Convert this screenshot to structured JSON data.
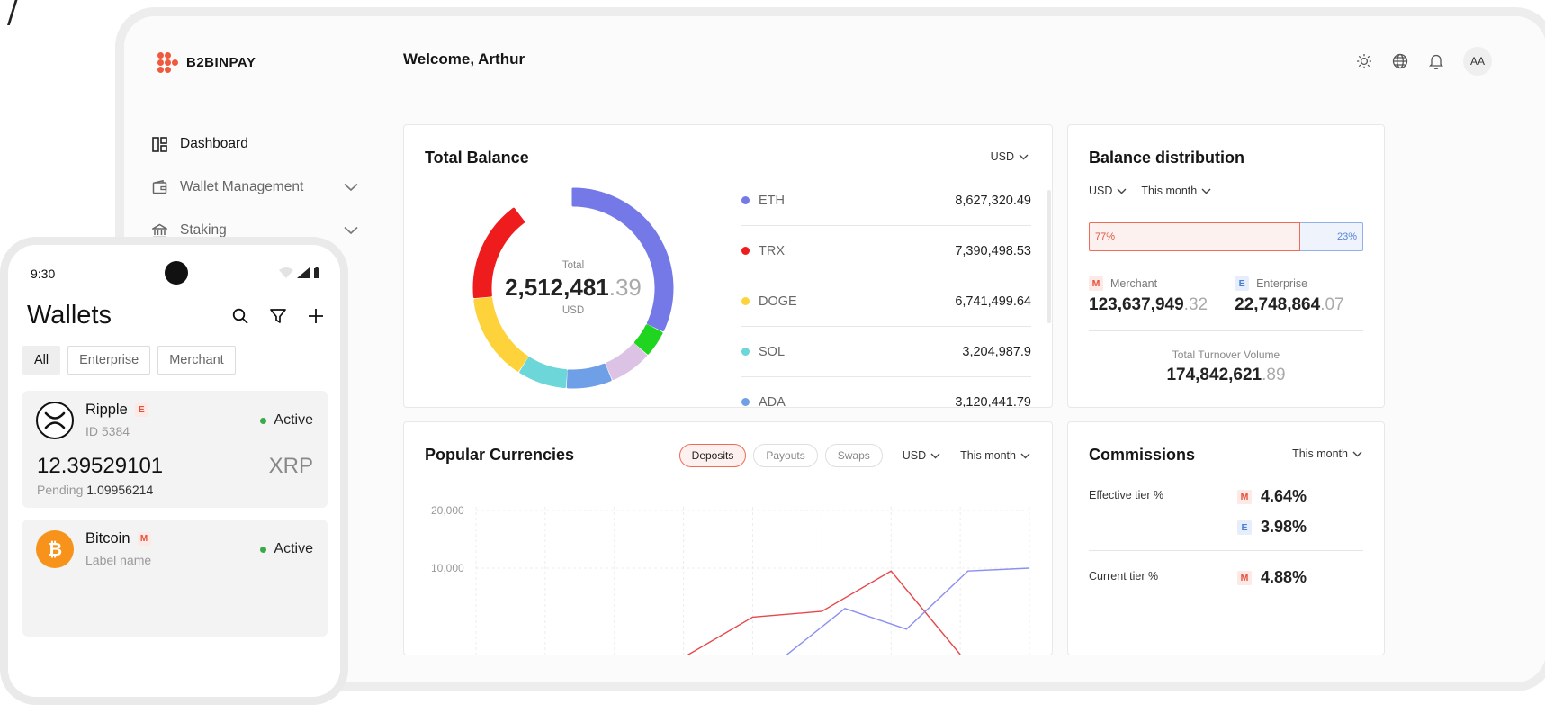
{
  "corner_glyph": "/",
  "brand": {
    "name": "B2BINPAY",
    "color": "#ef5a3c"
  },
  "sidebar": {
    "items": [
      {
        "label": "Dashboard",
        "icon": "dashboard-icon",
        "active": true
      },
      {
        "label": "Wallet Management",
        "icon": "wallet-icon",
        "expandable": true
      },
      {
        "label": "Staking",
        "icon": "bank-icon",
        "expandable": true
      }
    ]
  },
  "header": {
    "welcome": "Welcome, Arthur",
    "icons": [
      "sun-icon",
      "globe-icon",
      "bell-icon"
    ],
    "avatar": "AA"
  },
  "total_balance": {
    "title": "Total Balance",
    "currency": "USD",
    "center_label": "Total",
    "center_value_int": "2,512,481",
    "center_value_dec": ".39",
    "center_unit": "USD",
    "assets": [
      {
        "name": "ETH",
        "value": "8,627,320.49",
        "color": "#7579e8"
      },
      {
        "name": "TRX",
        "value": "7,390,498.53",
        "color": "#ee1c1c"
      },
      {
        "name": "DOGE",
        "value": "6,741,499.64",
        "color": "#fdd23a"
      },
      {
        "name": "SOL",
        "value": "3,204,987.9",
        "color": "#6cd6d8"
      },
      {
        "name": "ADA",
        "value": "3,120,441.79",
        "color": "#6f9fe7"
      }
    ],
    "donut_segments": [
      {
        "name": "ETH",
        "color": "#7579e8",
        "start_deg": 0,
        "end_deg": 115
      },
      {
        "name": "green",
        "color": "#1fd51f",
        "start_deg": 117,
        "end_deg": 131
      },
      {
        "name": "lavender",
        "color": "#dcc3e6",
        "start_deg": 133,
        "end_deg": 156
      },
      {
        "name": "ADA",
        "color": "#6f9fe7",
        "start_deg": 158,
        "end_deg": 183
      },
      {
        "name": "SOL",
        "color": "#6cd6d8",
        "start_deg": 185,
        "end_deg": 212
      },
      {
        "name": "DOGE",
        "color": "#fdd23a",
        "start_deg": 214,
        "end_deg": 263
      },
      {
        "name": "TRX",
        "color": "#ee1c1c",
        "start_deg": 265,
        "end_deg": 323
      }
    ]
  },
  "balance_distribution": {
    "title": "Balance distribution",
    "currency": "USD",
    "period": "This month",
    "merchant_pct_label": "77%",
    "enterprise_pct_label": "23%",
    "merchant_pct": 77,
    "merchant_tag": "M",
    "merchant_label": "Merchant",
    "merchant_value_int": "123,637,949",
    "merchant_value_dec": ".32",
    "enterprise_tag": "E",
    "enterprise_label": "Enterprise",
    "enterprise_value_int": "22,748,864",
    "enterprise_value_dec": ".07",
    "total_label": "Total Turnover Volume",
    "total_value_int": "174,842,621",
    "total_value_dec": ".89"
  },
  "popular_currencies": {
    "title": "Popular Currencies",
    "tabs": [
      {
        "label": "Deposits",
        "active": true
      },
      {
        "label": "Payouts",
        "active": false
      },
      {
        "label": "Swaps",
        "active": false
      }
    ],
    "currency": "USD",
    "period": "This month"
  },
  "chart_data": {
    "type": "line",
    "title": "Popular Currencies",
    "y_ticks": [
      "20,000",
      "10,000"
    ],
    "ylim": [
      0,
      20000
    ],
    "x_count": 9,
    "grid": true,
    "series": [
      {
        "color": "#e8474b",
        "values": [
          null,
          null,
          null,
          -5500,
          1500,
          2500,
          9500,
          -5000,
          null
        ]
      },
      {
        "color": "#8c8ff0",
        "values": [
          null,
          null,
          null,
          null,
          null,
          -5500,
          3000,
          -600,
          9500,
          10000
        ]
      }
    ]
  },
  "commissions": {
    "title": "Commissions",
    "period": "This month",
    "effective_label": "Effective tier %",
    "effective_m_tag": "M",
    "effective_m_value": "4.64%",
    "effective_e_tag": "E",
    "effective_e_value": "3.98%",
    "current_label": "Current tier %",
    "current_m_tag": "M",
    "current_m_value": "4.88%"
  },
  "phone": {
    "time": "9:30",
    "title": "Wallets",
    "filters": [
      {
        "label": "All",
        "active": true
      },
      {
        "label": "Enterprise",
        "active": false
      },
      {
        "label": "Merchant",
        "active": false
      }
    ],
    "wallets": [
      {
        "name": "Ripple",
        "tag": "E",
        "sub": "ID 5384",
        "status": "Active",
        "amount": "12.39529101",
        "code": "XRP",
        "pending_label": "Pending",
        "pending_value": "1.09956214",
        "icon": "ripple-icon"
      },
      {
        "name": "Bitcoin",
        "tag": "M",
        "sub": "Label name",
        "status": "Active",
        "icon": "bitcoin-icon"
      }
    ]
  }
}
